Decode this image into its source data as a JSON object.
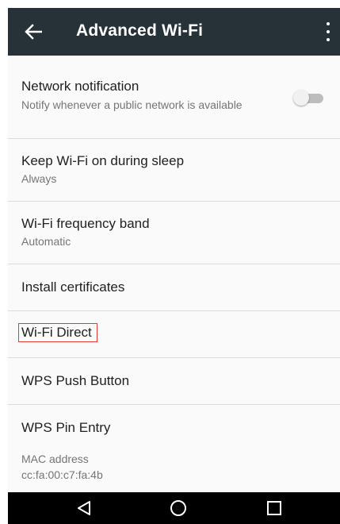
{
  "appbar": {
    "title": "Advanced Wi-Fi",
    "back_icon": "arrow-left-icon",
    "menu_icon": "more-vert-icon",
    "background": "#263238"
  },
  "settings": {
    "network_notification": {
      "title": "Network notification",
      "summary": "Notify whenever a public network is available",
      "toggle_on": false
    },
    "keep_wifi_on": {
      "title": "Keep Wi-Fi on during sleep",
      "summary": "Always"
    },
    "frequency_band": {
      "title": "Wi-Fi frequency band",
      "summary": "Automatic"
    },
    "install_certificates": {
      "title": "Install certificates"
    },
    "wifi_direct": {
      "title": "Wi-Fi Direct",
      "highlight_color": "#e53935"
    },
    "wps_push": {
      "title": "WPS Push Button"
    },
    "wps_pin": {
      "title": "WPS Pin Entry"
    }
  },
  "mac_address": {
    "label": "MAC address",
    "value": "cc:fa:00:c7:fa:4b"
  },
  "navbar": {
    "back_icon": "triangle-back-icon",
    "home_icon": "circle-home-icon",
    "recents_icon": "square-recents-icon"
  }
}
